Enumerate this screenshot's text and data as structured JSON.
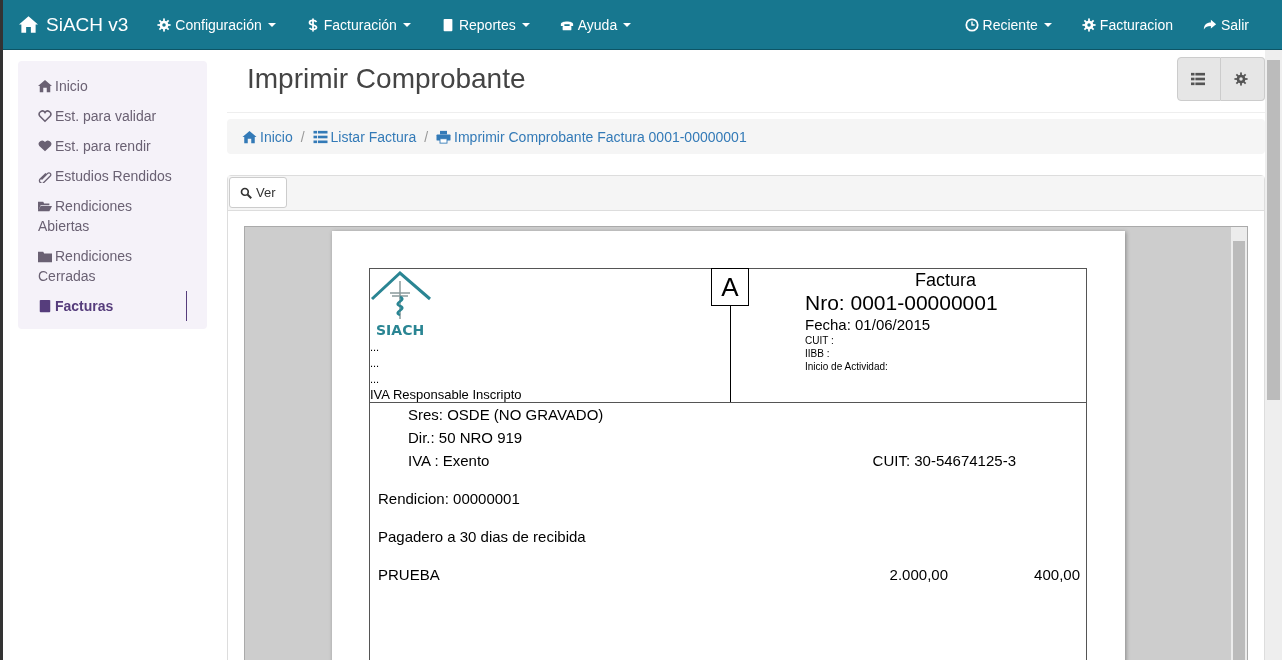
{
  "navbar": {
    "brand": "SiACH v3",
    "menus": [
      {
        "label": "Configuración",
        "kind": "gear",
        "dropdown": true
      },
      {
        "label": "Facturación",
        "kind": "dollar",
        "dropdown": true
      },
      {
        "label": "Reportes",
        "kind": "book",
        "dropdown": true
      },
      {
        "label": "Ayuda",
        "kind": "phone",
        "dropdown": true
      }
    ],
    "right_menus": [
      {
        "label": "Reciente",
        "kind": "clock",
        "dropdown": true
      },
      {
        "label": "Facturacion",
        "kind": "gear",
        "dropdown": false
      },
      {
        "label": "Salir",
        "kind": "share",
        "dropdown": false
      }
    ]
  },
  "sidebar": {
    "items": [
      {
        "label": "Inicio",
        "kind": "home",
        "selected": false
      },
      {
        "label": "Est. para validar",
        "kind": "heart-outline",
        "selected": false
      },
      {
        "label": "Est. para rendir",
        "kind": "heart",
        "selected": false
      },
      {
        "label": "Estudios Rendidos",
        "kind": "paperclip",
        "selected": false
      },
      {
        "label": "Rendiciones Abiertas",
        "kind": "folder-open",
        "selected": false
      },
      {
        "label": "Rendiciones Cerradas",
        "kind": "folder",
        "selected": false
      },
      {
        "label": "Facturas",
        "kind": "book",
        "selected": true
      }
    ]
  },
  "page_title": "Imprimir Comprobante",
  "header_buttons": [
    {
      "kind": "list"
    },
    {
      "kind": "gear"
    }
  ],
  "breadcrumb": {
    "separator": "/",
    "items": [
      {
        "label": "Inicio",
        "kind": "home"
      },
      {
        "label": "Listar Factura",
        "kind": "list"
      },
      {
        "label": "Imprimir Comprobante Factura 0001-00000001",
        "kind": "print"
      }
    ]
  },
  "view_button": "Ver",
  "invoice": {
    "logo_text": "SIACH",
    "issuer_lines": [
      "...",
      "...",
      "..."
    ],
    "iva": "IVA Responsable Inscripto",
    "letter": "A",
    "title": "Factura",
    "number": "Nro: 0001-00000001",
    "date": "Fecha: 01/06/2015",
    "small_lines": [
      "CUIT :",
      "IIBB :",
      "Inicio de Actividad:"
    ],
    "client": {
      "name": "Sres: OSDE (NO GRAVADO)",
      "address": "Dir.: 50 NRO 919",
      "iva": "IVA : Exento",
      "cuit": "CUIT: 30-54674125-3"
    },
    "rendicion": "Rendicion: 00000001",
    "terms": "Pagadero a 30 dias de recibida",
    "items": [
      {
        "description": "PRUEBA",
        "column_2": "2.000,00",
        "column_3": "400,00"
      }
    ]
  }
}
